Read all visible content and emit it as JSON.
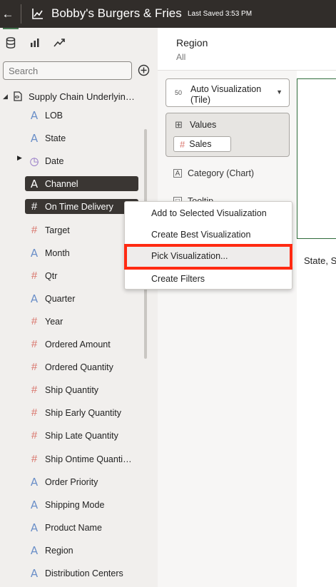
{
  "header": {
    "title": "Bobby's Burgers & Fries",
    "last_saved": "Last Saved 3:53 PM"
  },
  "panel": {
    "search_placeholder": "Search",
    "root_label": "Supply Chain Underlyin…",
    "items": [
      {
        "label": "LOB",
        "type": "attribute"
      },
      {
        "label": "State",
        "type": "attribute"
      },
      {
        "label": "Date",
        "type": "date"
      },
      {
        "label": "Channel",
        "type": "attribute",
        "selected": true
      },
      {
        "label": "On Time Delivery",
        "type": "measure",
        "selected": true
      },
      {
        "label": "Target",
        "type": "measure"
      },
      {
        "label": "Month",
        "type": "attribute"
      },
      {
        "label": "Qtr",
        "type": "measure"
      },
      {
        "label": "Quarter",
        "type": "attribute"
      },
      {
        "label": "Year",
        "type": "measure"
      },
      {
        "label": "Ordered Amount",
        "type": "measure"
      },
      {
        "label": "Ordered Quantity",
        "type": "measure"
      },
      {
        "label": "Ship Quantity",
        "type": "measure"
      },
      {
        "label": "Ship Early Quantity",
        "type": "measure"
      },
      {
        "label": "Ship Late Quantity",
        "type": "measure"
      },
      {
        "label": "Ship Ontime Quanti…",
        "type": "measure"
      },
      {
        "label": "Order Priority",
        "type": "attribute"
      },
      {
        "label": "Shipping Mode",
        "type": "attribute"
      },
      {
        "label": "Product Name",
        "type": "attribute"
      },
      {
        "label": "Region",
        "type": "attribute"
      },
      {
        "label": "Distribution Centers",
        "type": "attribute"
      }
    ]
  },
  "filter": {
    "name": "Region",
    "value": "All"
  },
  "grammar": {
    "viz_type": "Auto Visualization",
    "viz_type_sub": "(Tile)",
    "viz_icon_text": "50",
    "values_label": "Values",
    "values_pill": "Sales",
    "category_label": "Category (Chart)",
    "tooltip_label": "Tooltip"
  },
  "canvas": {
    "label": "State, S"
  },
  "context_menu": {
    "items": [
      "Add to Selected Visualization",
      "Create Best Visualization",
      "Pick Visualization...",
      "Create Filters"
    ],
    "highlighted_index": 2
  },
  "colors": {
    "header_bg": "#312d2a",
    "attribute_icon": "#6b8fc8",
    "measure_icon": "#d9746b",
    "date_icon": "#8a6bc2",
    "highlight": "#ff2a12",
    "selected_item_bg": "#3a3633"
  },
  "icons": {
    "back": "arrow-left-icon",
    "app": "chart-icon",
    "data_tab": "database-icon",
    "viz_tab": "visualization-icon",
    "analytics_tab": "analytics-icon",
    "add": "add-circle-icon",
    "attribute": "A",
    "measure": "#",
    "date": "clock-icon"
  }
}
